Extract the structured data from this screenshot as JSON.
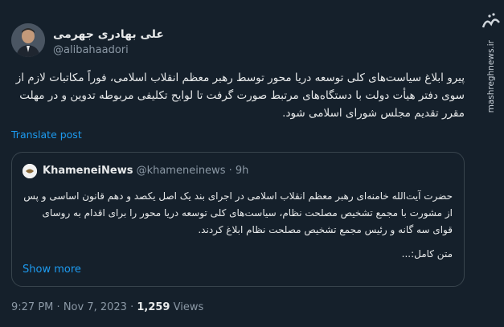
{
  "author": {
    "name": "علی بهادری جهرمی",
    "handle": "@alibahaadori"
  },
  "tweet": {
    "text": "پیرو ابلاغ سیاست‌های کلی توسعه دریا محور توسط رهبر معظم انقلاب اسلامی، فوراً مکاتبات لازم از سوی دفتر هیأت دولت با دستگاه‌های مرتبط صورت گرفت تا لوایح تکلیفی مربوطه تدوین و در مهلت مقرر تقدیم مجلس شورای اسلامی شود.",
    "translate_label": "Translate post"
  },
  "quote": {
    "name": "KhameneiNews",
    "handle": "@khameneinews",
    "separator": "·",
    "time": "9h",
    "text": "حضرت آیت‌الله خامنه‌ای رهبر معظم انقلاب اسلامی در اجرای بند یک اصل یکصد و دهم قانون اساسی و پس از مشورت با مجمع تشخیص مصلحت نظام، سیاست‌های کلی توسعه دریا محور را برای اقدام به روسای قوای سه گانه و رئیس مجمع تشخیص مصلحت نظام ابلاغ کردند.",
    "more_text": "متن کامل:...",
    "show_more_label": "Show more"
  },
  "footer": {
    "time": "9:27 PM",
    "date": "Nov 7, 2023",
    "separator": "·",
    "views_count": "1,259",
    "views_label": "Views"
  },
  "watermark": {
    "logo": "مشرق",
    "site": "mashreghnews.ir"
  }
}
